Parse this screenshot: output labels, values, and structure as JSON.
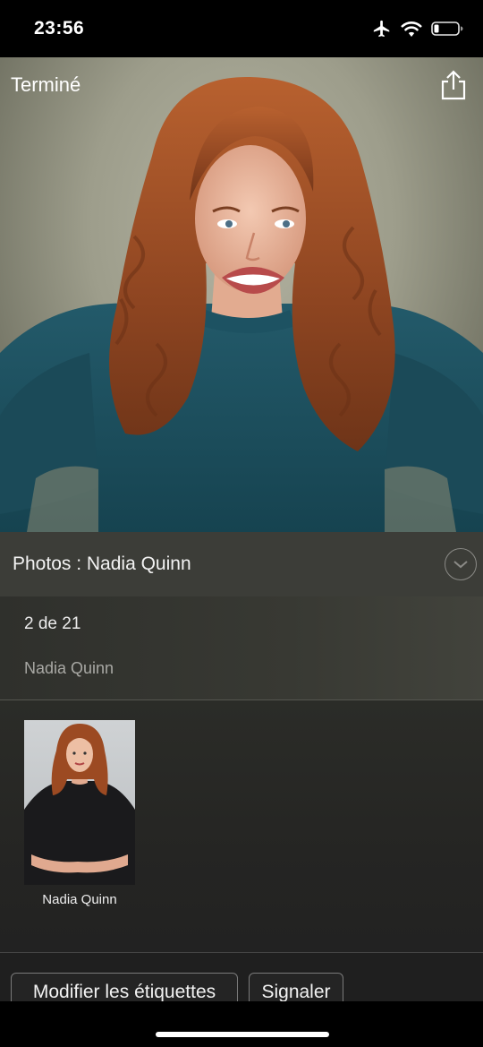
{
  "status_bar": {
    "time": "23:56",
    "icons": [
      "airplane-icon",
      "wifi-icon",
      "battery-icon"
    ]
  },
  "viewer": {
    "done_label": "Terminé",
    "share_icon": "share-icon"
  },
  "info": {
    "title": "Photos : Nadia Quinn",
    "counter": "2 de 21",
    "photographer": "Nadia Quinn",
    "expand_icon": "chevron-down-icon"
  },
  "people": [
    {
      "name": "Nadia Quinn"
    }
  ],
  "actions": {
    "edit_tags": "Modifier les étiquettes",
    "report": "Signaler"
  },
  "colors": {
    "panel": "#3c3d38",
    "background": "#1e1e1e",
    "hair": "#a04e26",
    "sweater": "#1c4f5e"
  }
}
